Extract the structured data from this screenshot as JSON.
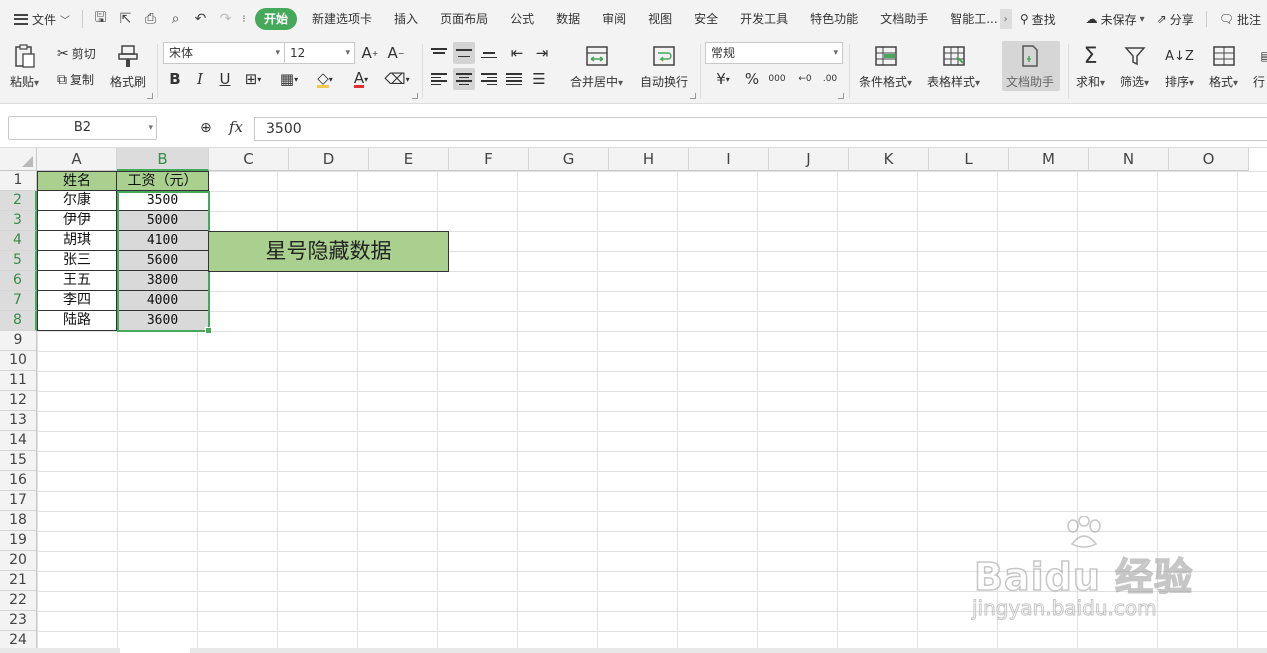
{
  "menubar": {
    "file_label": "文件",
    "tabs": [
      "开始",
      "新建选项卡",
      "插入",
      "页面布局",
      "公式",
      "数据",
      "审阅",
      "视图",
      "安全",
      "开发工具",
      "特色功能",
      "文档助手",
      "智能工..."
    ],
    "search_label": "查找",
    "unsaved_label": "未保存",
    "share_label": "分享",
    "comment_label": "批注"
  },
  "ribbon": {
    "paste": "粘贴",
    "cut": "剪切",
    "copy": "复制",
    "format_painter": "格式刷",
    "font_name": "宋体",
    "font_size": "12",
    "merge_center": "合并居中",
    "wrap_text": "自动换行",
    "number_format": "常规",
    "conditional_format": "条件格式",
    "table_style": "表格样式",
    "doc_assistant": "文档助手",
    "sum": "求和",
    "filter": "筛选",
    "sort": "排序",
    "format": "格式",
    "row_col": "行"
  },
  "formula_bar": {
    "name_box": "B2",
    "fx": "fx",
    "value": "3500"
  },
  "columns": [
    "A",
    "B",
    "C",
    "D",
    "E",
    "F",
    "G",
    "H",
    "I",
    "J",
    "K",
    "L",
    "M",
    "N",
    "O"
  ],
  "rows": [
    "1",
    "2",
    "3",
    "4",
    "5",
    "6",
    "7",
    "8",
    "9",
    "10",
    "11",
    "12",
    "13",
    "14",
    "15",
    "16",
    "17",
    "18",
    "19",
    "20",
    "21",
    "22",
    "23",
    "24"
  ],
  "table": {
    "header": [
      "姓名",
      "工资（元）"
    ],
    "rows": [
      [
        "尔康",
        "3500"
      ],
      [
        "伊伊",
        "5000"
      ],
      [
        "胡琪",
        "4100"
      ],
      [
        "张三",
        "5600"
      ],
      [
        "王五",
        "3800"
      ],
      [
        "李四",
        "4000"
      ],
      [
        "陆路",
        "3600"
      ]
    ]
  },
  "banner_text": "星号隐藏数据",
  "watermark": {
    "brand": "Baidu 经验",
    "url": "jingyan.baidu.com"
  },
  "colors": {
    "accent": "#46a85a",
    "header_fill": "#a9d08e",
    "data_fill": "#d9d9d9"
  }
}
